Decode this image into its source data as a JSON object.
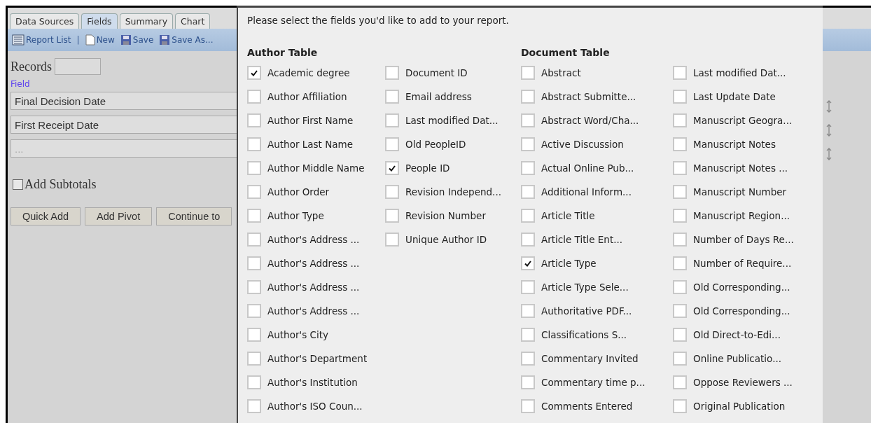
{
  "tabs": [
    {
      "label": "Data Sources",
      "selected": false
    },
    {
      "label": "Fields",
      "selected": true
    },
    {
      "label": "Summary",
      "selected": false
    },
    {
      "label": "Chart",
      "selected": false
    }
  ],
  "toolbar": [
    {
      "kind": "list",
      "label": "Report List"
    },
    {
      "kind": "separator",
      "label": "|"
    },
    {
      "kind": "new",
      "label": "New"
    },
    {
      "kind": "save",
      "label": "Save"
    },
    {
      "kind": "save",
      "label": "Save As..."
    }
  ],
  "records": {
    "label": "Records"
  },
  "field_label": "Field",
  "fields": [
    {
      "value": "Final Decision Date"
    },
    {
      "value": "First Receipt Date"
    },
    {
      "placeholder": "..."
    }
  ],
  "subtotals": {
    "label": "Add Subtotals",
    "checked": false
  },
  "buttons": [
    "Quick Add",
    "Add Pivot",
    "Continue to"
  ],
  "dialog": {
    "instruction": "Please select the fields you'd like to add to your report.",
    "tables": [
      {
        "title": "Author Table",
        "columns": [
          [
            {
              "label": "Academic degree",
              "checked": true
            },
            {
              "label": "Author Affiliation",
              "checked": false
            },
            {
              "label": "Author First Name",
              "checked": false
            },
            {
              "label": "Author Last Name",
              "checked": false
            },
            {
              "label": "Author Middle Name",
              "checked": false
            },
            {
              "label": "Author Order",
              "checked": false
            },
            {
              "label": "Author Type",
              "checked": false
            },
            {
              "label": "Author's Address ...",
              "checked": false
            },
            {
              "label": "Author's Address ...",
              "checked": false
            },
            {
              "label": "Author's Address ...",
              "checked": false
            },
            {
              "label": "Author's Address ...",
              "checked": false
            },
            {
              "label": "Author's City",
              "checked": false
            },
            {
              "label": "Author's Department",
              "checked": false
            },
            {
              "label": "Author's Institution",
              "checked": false
            },
            {
              "label": "Author's ISO Coun...",
              "checked": false
            }
          ],
          [
            {
              "label": "Document ID",
              "checked": false
            },
            {
              "label": "Email address",
              "checked": false
            },
            {
              "label": "Last modified Dat...",
              "checked": false
            },
            {
              "label": "Old PeopleID",
              "checked": false
            },
            {
              "label": "People ID",
              "checked": true
            },
            {
              "label": "Revision Independ...",
              "checked": false
            },
            {
              "label": "Revision Number",
              "checked": false
            },
            {
              "label": "Unique Author ID",
              "checked": false
            }
          ]
        ]
      },
      {
        "title": "Document Table",
        "columns": [
          [
            {
              "label": "Abstract",
              "checked": false
            },
            {
              "label": "Abstract Submitte...",
              "checked": false
            },
            {
              "label": "Abstract Word/Cha...",
              "checked": false
            },
            {
              "label": "Active Discussion",
              "checked": false
            },
            {
              "label": "Actual Online Pub...",
              "checked": false
            },
            {
              "label": "Additional Inform...",
              "checked": false
            },
            {
              "label": "Article Title",
              "checked": false
            },
            {
              "label": "Article Title Ent...",
              "checked": false
            },
            {
              "label": "Article Type",
              "checked": true
            },
            {
              "label": "Article Type Sele...",
              "checked": false
            },
            {
              "label": "Authoritative PDF...",
              "checked": false
            },
            {
              "label": "Classifications S...",
              "checked": false
            },
            {
              "label": "Commentary Invited",
              "checked": false
            },
            {
              "label": "Commentary time p...",
              "checked": false
            },
            {
              "label": "Comments Entered",
              "checked": false
            }
          ],
          [
            {
              "label": "Last modified Dat...",
              "checked": false
            },
            {
              "label": "Last Update Date",
              "checked": false
            },
            {
              "label": "Manuscript Geogra...",
              "checked": false
            },
            {
              "label": "Manuscript Notes",
              "checked": false
            },
            {
              "label": "Manuscript Notes ...",
              "checked": false
            },
            {
              "label": "Manuscript Number",
              "checked": false
            },
            {
              "label": "Manuscript Region...",
              "checked": false
            },
            {
              "label": "Number of Days Re...",
              "checked": false
            },
            {
              "label": "Number of Require...",
              "checked": false
            },
            {
              "label": "Old Corresponding...",
              "checked": false
            },
            {
              "label": "Old Corresponding...",
              "checked": false
            },
            {
              "label": "Old Direct-to-Edi...",
              "checked": false
            },
            {
              "label": "Online Publicatio...",
              "checked": false
            },
            {
              "label": "Oppose Reviewers ...",
              "checked": false
            },
            {
              "label": "Original Publication",
              "checked": false
            }
          ]
        ]
      }
    ]
  }
}
